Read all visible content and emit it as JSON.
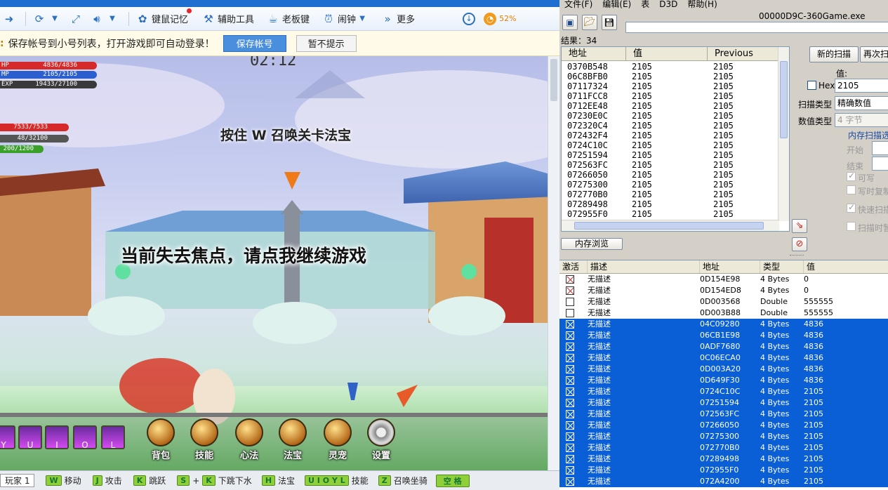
{
  "browser": {
    "toolbar": {
      "items": [
        "键鼠记忆",
        "辅助工具",
        "老板键",
        "闹钟",
        "更多"
      ],
      "cpu": "52%"
    },
    "notice": {
      "text": "保存帐号到小号列表，打开游戏即可自动登录！",
      "save_label": "保存帐号",
      "skip_label": "暂不提示"
    }
  },
  "game": {
    "hp": {
      "label": "HP",
      "value": "4836/4836"
    },
    "mp": {
      "label": "MP",
      "value": "2105/2105"
    },
    "exp": {
      "label": "EXP",
      "value": "19433/27100"
    },
    "pet_hp": "7533/7533",
    "pet_val2": "48/32100",
    "pet_val3": "200/1200",
    "timer": "02:12",
    "hint_summon": "按住 W 召唤关卡法宝",
    "hint_focus": "当前失去焦点，请点我继续游戏",
    "skill_keys": [
      "Y",
      "U",
      "I",
      "O",
      "L"
    ],
    "menu": [
      "背包",
      "技能",
      "心法",
      "法宝",
      "灵宠",
      "设置"
    ],
    "bottom": {
      "player": "玩家 1",
      "move": "移动",
      "attack_key": "J",
      "attack": "攻击",
      "jump_key": "K",
      "jump": "跳跃",
      "s_key": "S",
      "plus": "+",
      "k_key": "K",
      "down": "下跳下水",
      "h_key": "H",
      "fabao": "法宝",
      "skill_keys": "U I O Y L",
      "skill": "技能",
      "z_key": "Z",
      "mount": "召唤坐骑",
      "space": "空 格"
    }
  },
  "ce": {
    "menu": [
      "文件(F)",
      "编辑(E)",
      "表",
      "D3D",
      "帮助(H)"
    ],
    "process": "00000D9C-360Game.exe",
    "result_count": "结果：34",
    "columns": {
      "address": "地址",
      "value": "值",
      "previous": "Previous"
    },
    "scan_results": [
      {
        "addr": "0370B548",
        "val": "2105",
        "prev": "2105"
      },
      {
        "addr": "06C8BFB0",
        "val": "2105",
        "prev": "2105"
      },
      {
        "addr": "07117324",
        "val": "2105",
        "prev": "2105"
      },
      {
        "addr": "0711FCC8",
        "val": "2105",
        "prev": "2105"
      },
      {
        "addr": "0712EE48",
        "val": "2105",
        "prev": "2105"
      },
      {
        "addr": "07230E0C",
        "val": "2105",
        "prev": "2105"
      },
      {
        "addr": "072320C4",
        "val": "2105",
        "prev": "2105"
      },
      {
        "addr": "072432F4",
        "val": "2105",
        "prev": "2105"
      },
      {
        "addr": "0724C10C",
        "val": "2105",
        "prev": "2105"
      },
      {
        "addr": "07251594",
        "val": "2105",
        "prev": "2105"
      },
      {
        "addr": "072563FC",
        "val": "2105",
        "prev": "2105"
      },
      {
        "addr": "07266050",
        "val": "2105",
        "prev": "2105"
      },
      {
        "addr": "07275300",
        "val": "2105",
        "prev": "2105"
      },
      {
        "addr": "072770B0",
        "val": "2105",
        "prev": "2105"
      },
      {
        "addr": "07289498",
        "val": "2105",
        "prev": "2105"
      },
      {
        "addr": "072955F0",
        "val": "2105",
        "prev": "2105"
      }
    ],
    "new_scan": "新的扫描",
    "next_scan": "再次扫",
    "value_label": "值:",
    "hex_label": "Hex",
    "value_input": "2105",
    "scan_type_label": "扫描类型",
    "scan_type": "精确数值",
    "value_type_label": "数值类型",
    "value_type": "4 字节",
    "memscan_title": "内存扫描选",
    "start_label": "开始",
    "end_label": "结束",
    "writable": "可写",
    "copy_on_write": "写时复制",
    "fast_scan": "快速扫描",
    "pause_scan": "扫描时暂",
    "mem_view": "内存浏览",
    "addr_columns": {
      "active": "激活",
      "desc": "描述",
      "addr": "地址",
      "type": "类型",
      "value": "值"
    },
    "entries": [
      {
        "desc": "无描述",
        "addr": "0D154E98",
        "type": "4 Bytes",
        "value": "0",
        "x": true,
        "sel": false
      },
      {
        "desc": "无描述",
        "addr": "0D154ED8",
        "type": "4 Bytes",
        "value": "0",
        "x": true,
        "sel": false
      },
      {
        "desc": "无描述",
        "addr": "0D003568",
        "type": "Double",
        "value": "555555",
        "x": false,
        "sel": false
      },
      {
        "desc": "无描述",
        "addr": "0D003B88",
        "type": "Double",
        "value": "555555",
        "x": false,
        "sel": false
      },
      {
        "desc": "无描述",
        "addr": "04C09280",
        "type": "4 Bytes",
        "value": "4836",
        "x": true,
        "sel": true
      },
      {
        "desc": "无描述",
        "addr": "06CB1E98",
        "type": "4 Bytes",
        "value": "4836",
        "x": true,
        "sel": true
      },
      {
        "desc": "无描述",
        "addr": "0ADF7680",
        "type": "4 Bytes",
        "value": "4836",
        "x": true,
        "sel": true
      },
      {
        "desc": "无描述",
        "addr": "0C06ECA0",
        "type": "4 Bytes",
        "value": "4836",
        "x": true,
        "sel": true
      },
      {
        "desc": "无描述",
        "addr": "0D003A20",
        "type": "4 Bytes",
        "value": "4836",
        "x": true,
        "sel": true
      },
      {
        "desc": "无描述",
        "addr": "0D649F30",
        "type": "4 Bytes",
        "value": "4836",
        "x": true,
        "sel": true
      },
      {
        "desc": "无描述",
        "addr": "0724C10C",
        "type": "4 Bytes",
        "value": "2105",
        "x": true,
        "sel": true
      },
      {
        "desc": "无描述",
        "addr": "07251594",
        "type": "4 Bytes",
        "value": "2105",
        "x": true,
        "sel": true
      },
      {
        "desc": "无描述",
        "addr": "072563FC",
        "type": "4 Bytes",
        "value": "2105",
        "x": true,
        "sel": true
      },
      {
        "desc": "无描述",
        "addr": "07266050",
        "type": "4 Bytes",
        "value": "2105",
        "x": true,
        "sel": true
      },
      {
        "desc": "无描述",
        "addr": "07275300",
        "type": "4 Bytes",
        "value": "2105",
        "x": true,
        "sel": true
      },
      {
        "desc": "无描述",
        "addr": "072770B0",
        "type": "4 Bytes",
        "value": "2105",
        "x": true,
        "sel": true
      },
      {
        "desc": "无描述",
        "addr": "07289498",
        "type": "4 Bytes",
        "value": "2105",
        "x": true,
        "sel": true
      },
      {
        "desc": "无描述",
        "addr": "072955F0",
        "type": "4 Bytes",
        "value": "2105",
        "x": true,
        "sel": true
      },
      {
        "desc": "无描述",
        "addr": "072A4200",
        "type": "4 Bytes",
        "value": "2105",
        "x": true,
        "sel": true
      }
    ]
  },
  "colors": {
    "selection": "#0a5fd6",
    "hp": "#d62a2a",
    "mp": "#2b5fcf",
    "exp": "#e0c020"
  }
}
